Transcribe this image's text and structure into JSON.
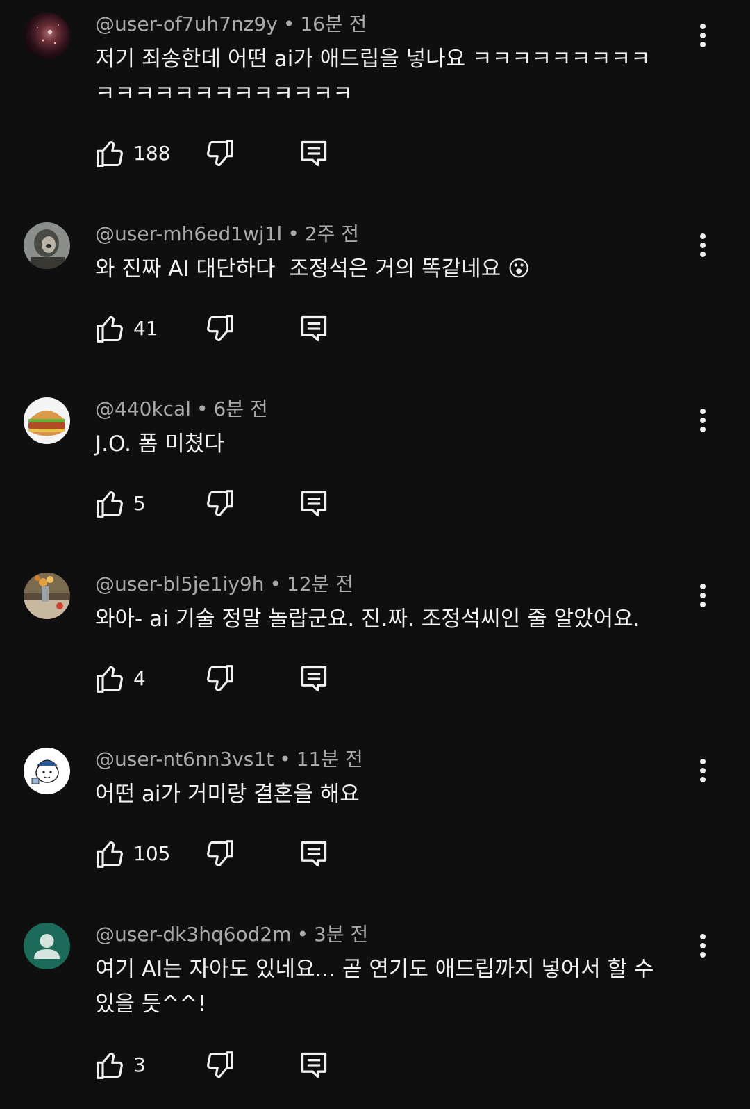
{
  "comments": [
    {
      "author": "@user-of7uh7nz9y",
      "time": "16분 전",
      "text": "저기 죄송한데 어떤 ai가 애드립을 넣나요 ㅋㅋㅋㅋㅋㅋㅋㅋㅋ\nㅋㅋㅋㅋㅋㅋㅋㅋㅋㅋㅋㅋㅋ",
      "likes": "188",
      "avatar": "space-nebula-avatar"
    },
    {
      "author": "@user-mh6ed1wj1l",
      "time": "2주 전",
      "text": "와 진짜 AI 대단하다  조정석은 거의 똑같네요 😮",
      "likes": "41",
      "avatar": "sloth-avatar"
    },
    {
      "author": "@440kcal",
      "time": "6분 전",
      "text": "J.O. 폼 미쳤다",
      "likes": "5",
      "avatar": "burger-avatar"
    },
    {
      "author": "@user-bl5je1iy9h",
      "time": "12분 전",
      "text": "와아- ai 기술 정말 놀랍군요. 진.짜. 조정석씨인 줄 알았어요.",
      "likes": "4",
      "avatar": "flowers-table-avatar"
    },
    {
      "author": "@user-nt6nn3vs1t",
      "time": "11분 전",
      "text": "어떤 ai가 거미랑 결혼을 해요",
      "likes": "105",
      "avatar": "cartoon-character-avatar"
    },
    {
      "author": "@user-dk3hq6od2m",
      "time": "3분 전",
      "text": "여기 AI는 자아도 있네요... 곧 연기도 애드립까지 넣어서 할 수\n있을 듯^^!",
      "likes": "3",
      "avatar": "default-person-avatar"
    }
  ],
  "separator": "•",
  "icons": {
    "like": "thumbs-up-icon",
    "dislike": "thumbs-down-icon",
    "reply": "reply-comment-icon",
    "menu": "more-vertical-icon"
  },
  "colors": {
    "background": "#0f0f0f",
    "text": "#f1f1f1",
    "meta": "#aaaaaa",
    "default_avatar": "#1c6a5a"
  }
}
